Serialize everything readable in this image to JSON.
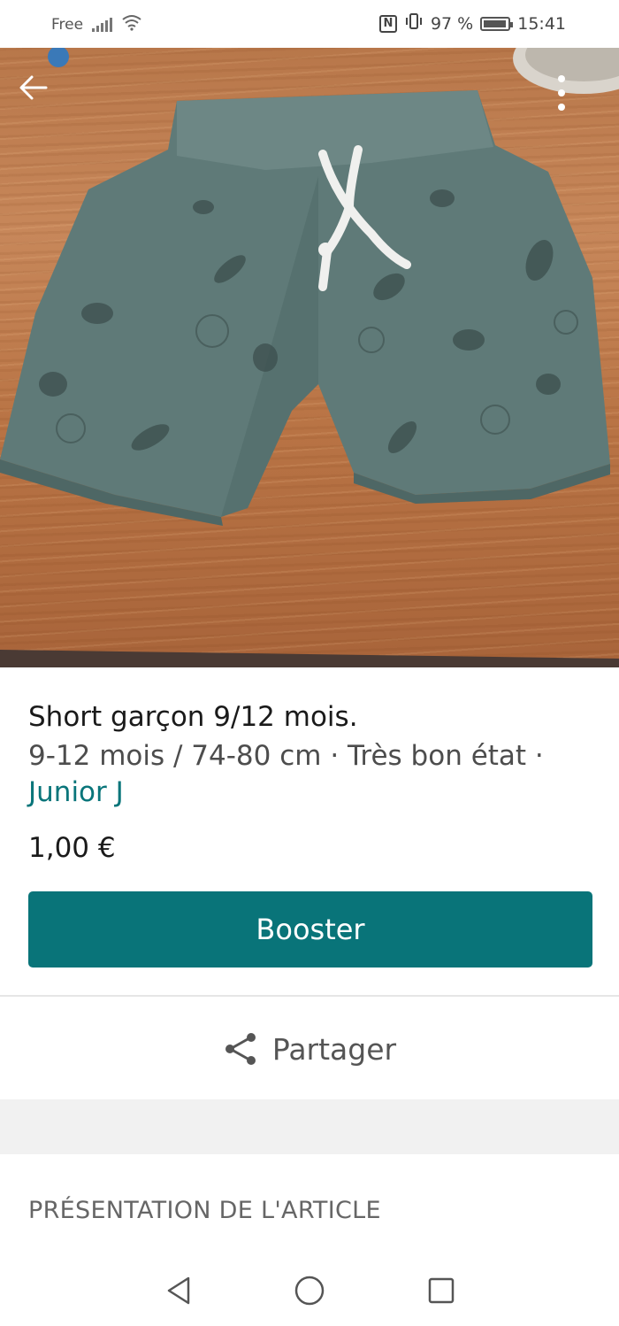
{
  "status_bar": {
    "carrier": "Free",
    "battery_percent": "97 %",
    "battery_level": 0.97,
    "time": "15:41",
    "nfc_label": "N"
  },
  "photo": {
    "description_icons": {
      "back": "back-arrow-icon",
      "more": "more-vertical-icon"
    }
  },
  "item": {
    "title": "Short garçon 9/12 mois.",
    "meta": "9-12 mois / 74-80 cm · Très bon état ·",
    "brand": "Junior J",
    "price": "1,00 €"
  },
  "actions": {
    "booster_label": "Booster",
    "share_label": "Partager"
  },
  "section": {
    "title": "PRÉSENTATION DE L'ARTICLE"
  },
  "colors": {
    "accent": "#09757a",
    "button": "#097479"
  }
}
